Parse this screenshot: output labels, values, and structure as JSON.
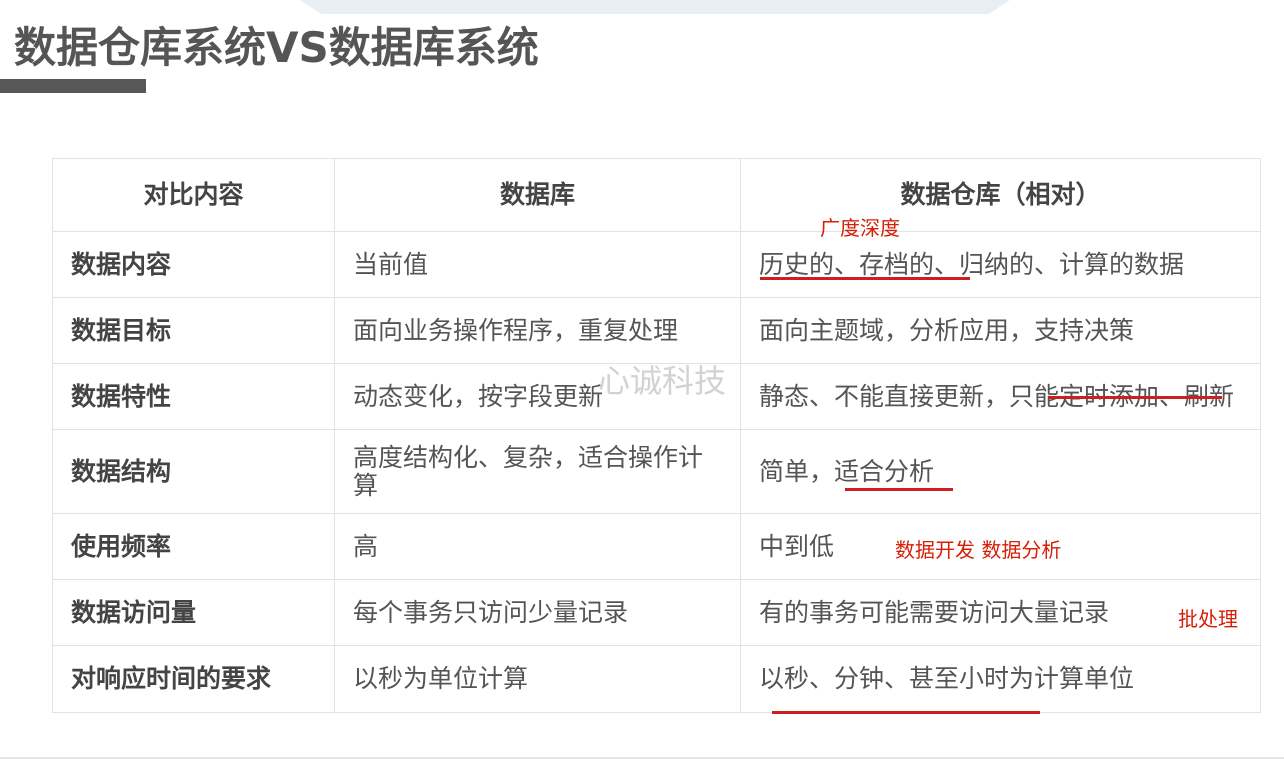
{
  "title": "数据仓库系统VS数据库系统",
  "watermark": "心诚科技",
  "table": {
    "headers": [
      "对比内容",
      "数据库",
      "数据仓库（相对）"
    ],
    "rows": [
      [
        "数据内容",
        "当前值",
        "历史的、存档的、归纳的、计算的数据"
      ],
      [
        "数据目标",
        "面向业务操作程序，重复处理",
        "面向主题域，分析应用，支持决策"
      ],
      [
        "数据特性",
        "动态变化，按字段更新",
        "静态、不能直接更新，只能定时添加、刷新"
      ],
      [
        "数据结构",
        "高度结构化、复杂，适合操作计算",
        "简单，适合分析"
      ],
      [
        "使用频率",
        "高",
        "中到低"
      ],
      [
        "数据访问量",
        "每个事务只访问少量记录",
        "有的事务可能需要访问大量记录"
      ],
      [
        "对响应时间的要求",
        "以秒为单位计算",
        "以秒、分钟、甚至小时为计算单位"
      ]
    ]
  },
  "annotations": {
    "breadth_depth": "广度深度",
    "dev_analysis": "数据开发 数据分析",
    "batch": "批处理"
  }
}
